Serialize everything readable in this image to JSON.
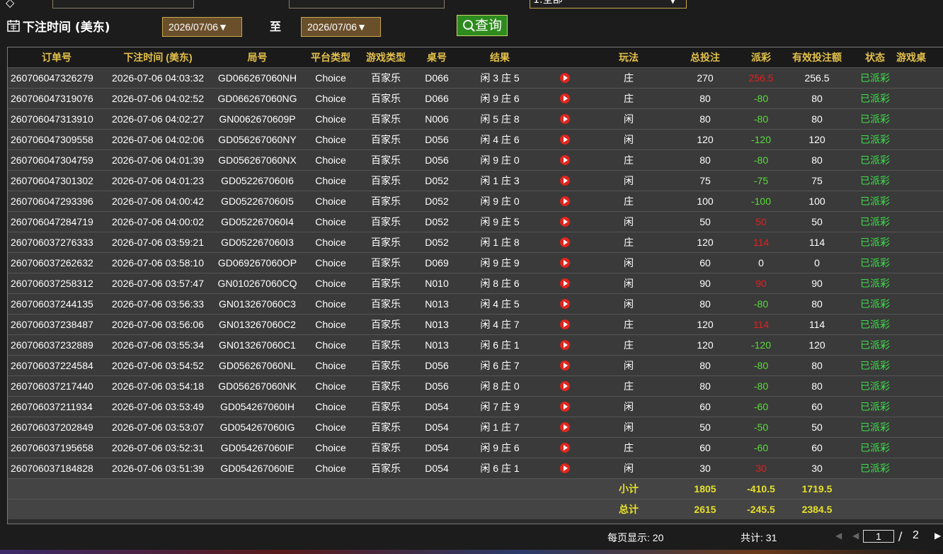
{
  "filters": {
    "select_value": "1:全部",
    "time_label": "下注时间 (美东)",
    "date_from": "2026/07/06▼",
    "to_label": "至",
    "date_to": "2026/07/06▼",
    "query_label": "查询"
  },
  "table": {
    "headers": [
      "订单号",
      "下注时间 (美东)",
      "局号",
      "平台类型",
      "游戏类型",
      "桌号",
      "结果",
      "",
      "玩法",
      "总投注",
      "派彩",
      "有效投注额",
      "状态",
      "游戏桌"
    ],
    "rows": [
      [
        "260706047326279",
        "2026-07-06 04:03:32",
        "GD066267060NH",
        "Choice",
        "百家乐",
        "D066",
        "闲 3 庄 5",
        "庄",
        "270",
        "256.5",
        "256.5",
        "已派彩",
        "-"
      ],
      [
        "260706047319076",
        "2026-07-06 04:02:52",
        "GD066267060NG",
        "Choice",
        "百家乐",
        "D066",
        "闲 9 庄 6",
        "庄",
        "80",
        "-80",
        "80",
        "已派彩",
        "-"
      ],
      [
        "260706047313910",
        "2026-07-06 04:02:27",
        "GN0062670609P",
        "Choice",
        "百家乐",
        "N006",
        "闲 5 庄 8",
        "闲",
        "80",
        "-80",
        "80",
        "已派彩",
        "-"
      ],
      [
        "260706047309558",
        "2026-07-06 04:02:06",
        "GD056267060NY",
        "Choice",
        "百家乐",
        "D056",
        "闲 4 庄 6",
        "闲",
        "120",
        "-120",
        "120",
        "已派彩",
        "-"
      ],
      [
        "260706047304759",
        "2026-07-06 04:01:39",
        "GD056267060NX",
        "Choice",
        "百家乐",
        "D056",
        "闲 9 庄 0",
        "庄",
        "80",
        "-80",
        "80",
        "已派彩",
        "-"
      ],
      [
        "260706047301302",
        "2026-07-06 04:01:23",
        "GD052267060I6",
        "Choice",
        "百家乐",
        "D052",
        "闲 1 庄 3",
        "闲",
        "75",
        "-75",
        "75",
        "已派彩",
        "-"
      ],
      [
        "260706047293396",
        "2026-07-06 04:00:42",
        "GD052267060I5",
        "Choice",
        "百家乐",
        "D052",
        "闲 9 庄 0",
        "庄",
        "100",
        "-100",
        "100",
        "已派彩",
        "-"
      ],
      [
        "260706047284719",
        "2026-07-06 04:00:02",
        "GD052267060I4",
        "Choice",
        "百家乐",
        "D052",
        "闲 9 庄 5",
        "闲",
        "50",
        "50",
        "50",
        "已派彩",
        "-"
      ],
      [
        "260706037276333",
        "2026-07-06 03:59:21",
        "GD052267060I3",
        "Choice",
        "百家乐",
        "D052",
        "闲 1 庄 8",
        "庄",
        "120",
        "114",
        "114",
        "已派彩",
        "-"
      ],
      [
        "260706037262632",
        "2026-07-06 03:58:10",
        "GD069267060OP",
        "Choice",
        "百家乐",
        "D069",
        "闲 9 庄 9",
        "闲",
        "60",
        "0",
        "0",
        "已派彩",
        "-"
      ],
      [
        "260706037258312",
        "2026-07-06 03:57:47",
        "GN010267060CQ",
        "Choice",
        "百家乐",
        "N010",
        "闲 8 庄 6",
        "闲",
        "90",
        "90",
        "90",
        "已派彩",
        "-"
      ],
      [
        "260706037244135",
        "2026-07-06 03:56:33",
        "GN013267060C3",
        "Choice",
        "百家乐",
        "N013",
        "闲 4 庄 5",
        "闲",
        "80",
        "-80",
        "80",
        "已派彩",
        "-"
      ],
      [
        "260706037238487",
        "2026-07-06 03:56:06",
        "GN013267060C2",
        "Choice",
        "百家乐",
        "N013",
        "闲 4 庄 7",
        "庄",
        "120",
        "114",
        "114",
        "已派彩",
        "-"
      ],
      [
        "260706037232889",
        "2026-07-06 03:55:34",
        "GN013267060C1",
        "Choice",
        "百家乐",
        "N013",
        "闲 6 庄 1",
        "庄",
        "120",
        "-120",
        "120",
        "已派彩",
        "-"
      ],
      [
        "260706037224584",
        "2026-07-06 03:54:52",
        "GD056267060NL",
        "Choice",
        "百家乐",
        "D056",
        "闲 6 庄 7",
        "闲",
        "80",
        "-80",
        "80",
        "已派彩",
        "-"
      ],
      [
        "260706037217440",
        "2026-07-06 03:54:18",
        "GD056267060NK",
        "Choice",
        "百家乐",
        "D056",
        "闲 8 庄 0",
        "庄",
        "80",
        "-80",
        "80",
        "已派彩",
        "-"
      ],
      [
        "260706037211934",
        "2026-07-06 03:53:49",
        "GD054267060IH",
        "Choice",
        "百家乐",
        "D054",
        "闲 7 庄 9",
        "闲",
        "60",
        "-60",
        "60",
        "已派彩",
        "-"
      ],
      [
        "260706037202849",
        "2026-07-06 03:53:07",
        "GD054267060IG",
        "Choice",
        "百家乐",
        "D054",
        "闲 1 庄 7",
        "闲",
        "50",
        "-50",
        "50",
        "已派彩",
        "-"
      ],
      [
        "260706037195658",
        "2026-07-06 03:52:31",
        "GD054267060IF",
        "Choice",
        "百家乐",
        "D054",
        "闲 9 庄 6",
        "庄",
        "60",
        "-60",
        "60",
        "已派彩",
        "-"
      ],
      [
        "260706037184828",
        "2026-07-06 03:51:39",
        "GD054267060IE",
        "Choice",
        "百家乐",
        "D054",
        "闲 6 庄 1",
        "闲",
        "30",
        "30",
        "30",
        "已派彩",
        "-"
      ]
    ],
    "subtotal": {
      "label": "小计",
      "total_bet": "1805",
      "payout": "-410.5",
      "valid_bet": "1719.5"
    },
    "total": {
      "label": "总计",
      "total_bet": "2615",
      "payout": "-245.5",
      "valid_bet": "2384.5"
    }
  },
  "pagination": {
    "page_size_text": "每页显示: 20",
    "total_text": "共计: 31",
    "current_page": "1",
    "slash": "/",
    "total_pages": "2"
  },
  "icons": {
    "play": "play-icon",
    "calendar": "calendar-icon",
    "search": "search-icon"
  },
  "colors": {
    "header_text": "#e3c04a",
    "payout_negative": "#5adc3a",
    "payout_positive": "#e02020",
    "status_paid": "#3ce04a",
    "summary_text": "#e6e02a",
    "query_button": "#2e8b1e"
  }
}
